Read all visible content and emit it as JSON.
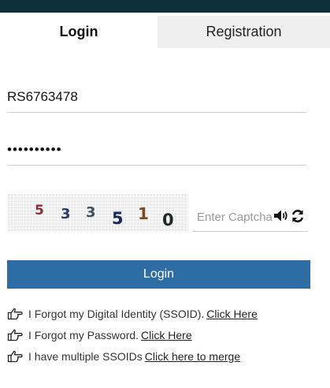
{
  "tabs": [
    {
      "label": "Login",
      "active": true
    },
    {
      "label": "Registration",
      "active": false
    }
  ],
  "form": {
    "ssoid_value": "RS6763478",
    "password_value": "••••••••••",
    "captcha_digits": [
      "5",
      "3",
      "3",
      "5",
      "1",
      "0"
    ],
    "captcha_placeholder": "Enter Captcha",
    "speaker_icon": "speaker-icon",
    "refresh_icon": "refresh-icon",
    "login_label": "Login"
  },
  "help": [
    {
      "text": "I Forgot my Digital Identity (SSOID).",
      "link": "Click Here"
    },
    {
      "text": "I Forgot my Password.",
      "link": "Click Here"
    },
    {
      "text": "I have multiple SSOIDs",
      "link": "Click here to merge"
    }
  ],
  "colors": {
    "topbar": "#0f2f3a",
    "button": "#2e6da4",
    "inactive_tab": "#efefef"
  }
}
